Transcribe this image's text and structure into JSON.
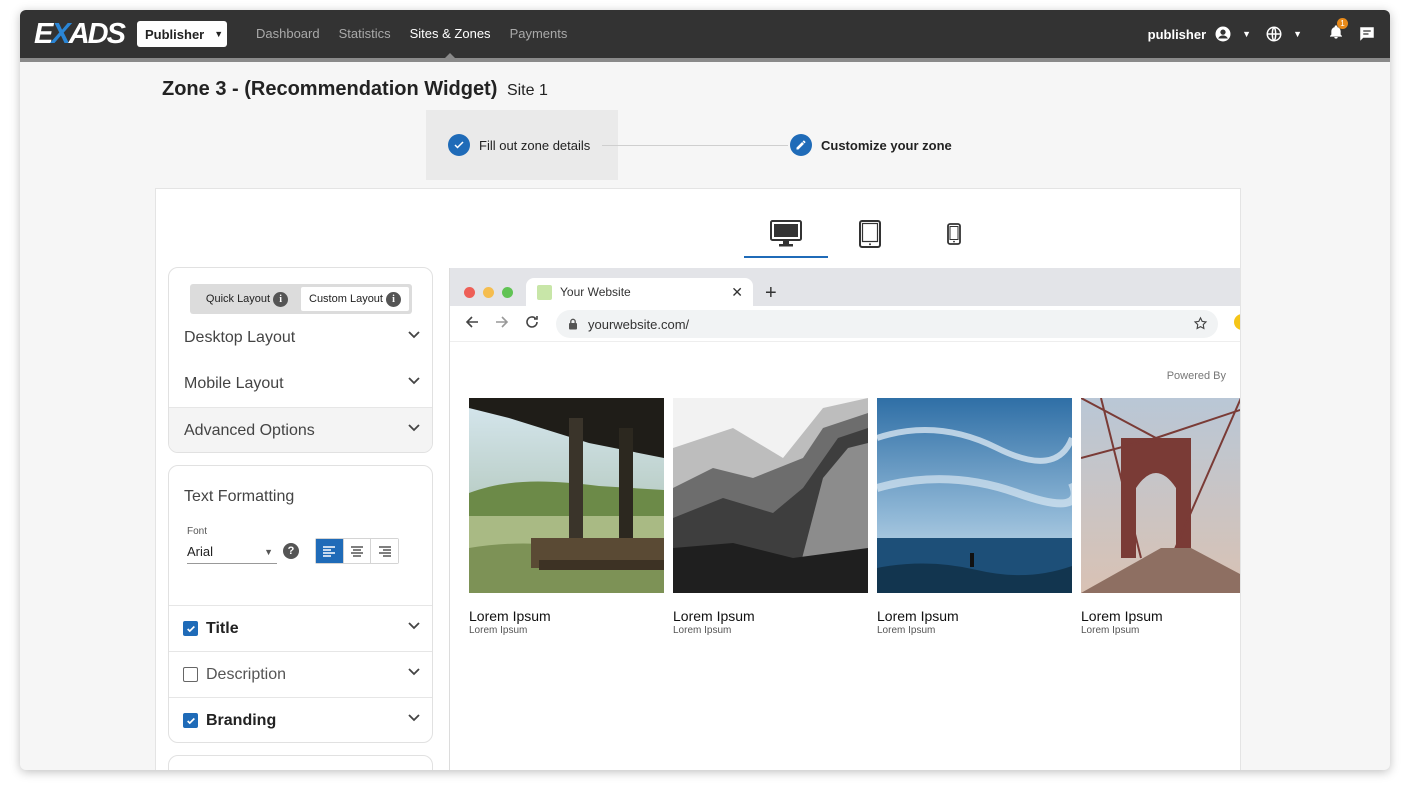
{
  "nav": {
    "logo_prefix": "E",
    "logo_x": "X",
    "logo_suffix": "ADS",
    "role_dropdown": "Publisher",
    "links": [
      "Dashboard",
      "Statistics",
      "Sites & Zones",
      "Payments"
    ],
    "active_link": "Sites & Zones",
    "username": "publisher",
    "notification_count": "1"
  },
  "header": {
    "title": "Zone 3 - (Recommendation Widget)",
    "site": "Site 1"
  },
  "stepper": {
    "steps": [
      {
        "label": "Fill out zone details",
        "state": "done"
      },
      {
        "label": "Customize your zone",
        "state": "active"
      }
    ]
  },
  "devices": [
    "desktop-icon",
    "tablet-icon",
    "mobile-icon"
  ],
  "layout_card": {
    "tabs": [
      "Quick Layout",
      "Custom Layout"
    ],
    "active_tab": "Custom Layout",
    "sections": [
      "Desktop Layout",
      "Mobile Layout",
      "Advanced Options"
    ]
  },
  "text_formatting": {
    "title": "Text Formatting",
    "font_label": "Font",
    "font_value": "Arial",
    "alignment": "left",
    "options": [
      {
        "label": "Title",
        "checked": true
      },
      {
        "label": "Description",
        "checked": false
      },
      {
        "label": "Branding",
        "checked": true
      }
    ]
  },
  "browser": {
    "tab_title": "Your Website",
    "url": "yourwebsite.com/",
    "powered_by": "Powered By"
  },
  "recommendations": [
    {
      "title": "Lorem Ipsum",
      "desc": "Lorem Ipsum"
    },
    {
      "title": "Lorem Ipsum",
      "desc": "Lorem Ipsum"
    },
    {
      "title": "Lorem Ipsum",
      "desc": "Lorem Ipsum"
    },
    {
      "title": "Lorem Ipsum",
      "desc": "Lorem Ipsum"
    }
  ],
  "colors": {
    "nav_bg": "#333333",
    "accent_blue": "#1f6bb8",
    "badge_orange": "#e88a1a"
  }
}
